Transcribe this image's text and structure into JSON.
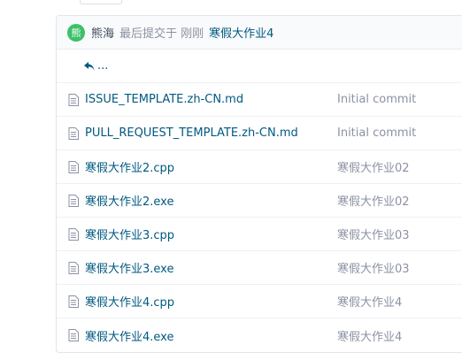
{
  "latest_commit": {
    "avatar_text": "熊",
    "author": "熊海",
    "meta": "最后提交于 刚刚",
    "message": "寒假大作业4"
  },
  "parent_dir": {
    "label": "..."
  },
  "files": [
    {
      "name": "ISSUE_TEMPLATE.zh-CN.md",
      "commit": "Initial commit"
    },
    {
      "name": "PULL_REQUEST_TEMPLATE.zh-CN.md",
      "commit": "Initial commit"
    },
    {
      "name": "寒假大作业2.cpp",
      "commit": "寒假大作业02"
    },
    {
      "name": "寒假大作业2.exe",
      "commit": "寒假大作业02"
    },
    {
      "name": "寒假大作业3.cpp",
      "commit": "寒假大作业03"
    },
    {
      "name": "寒假大作业3.exe",
      "commit": "寒假大作业03"
    },
    {
      "name": "寒假大作业4.cpp",
      "commit": "寒假大作业4"
    },
    {
      "name": "寒假大作业4.exe",
      "commit": "寒假大作业4"
    }
  ],
  "colors": {
    "link": "#005980",
    "muted": "#8c92a4",
    "avatar": "#3ec06a"
  },
  "icons": {
    "back": "reply-arrow-icon",
    "file": "file-text-icon"
  }
}
